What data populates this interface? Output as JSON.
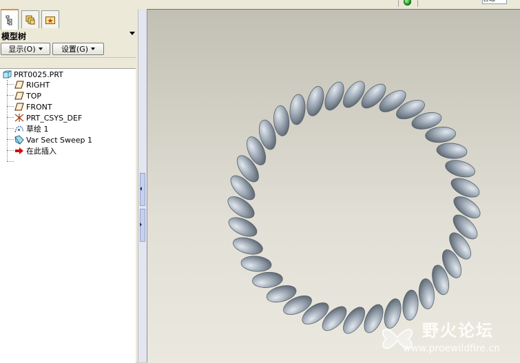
{
  "top_box": {
    "text": "普通"
  },
  "panel": {
    "title": "模型树",
    "show_button": "显示(O)",
    "settings_button": "设置(G)"
  },
  "tabs": [
    {
      "icon": "model-tree-tab-icon",
      "active": true
    },
    {
      "icon": "layers-tab-icon",
      "active": false
    },
    {
      "icon": "favorites-tab-icon",
      "active": false
    }
  ],
  "tree": {
    "root": "PRT0025.PRT",
    "items": [
      {
        "label": "RIGHT",
        "icon": "datum-plane-icon"
      },
      {
        "label": "TOP",
        "icon": "datum-plane-icon"
      },
      {
        "label": "FRONT",
        "icon": "datum-plane-icon"
      },
      {
        "label": "PRT_CSYS_DEF",
        "icon": "csys-icon"
      },
      {
        "label": "草绘 1",
        "icon": "sketch-icon"
      },
      {
        "label": "Var Sect Sweep 1",
        "icon": "var-sect-sweep-icon"
      },
      {
        "label": "在此插入",
        "icon": "insert-here-arrow-icon"
      }
    ]
  },
  "watermark": {
    "name": "野火论坛",
    "url": "www.proewildfire.cn"
  },
  "colors": {
    "model": "#9aa6b3",
    "insert_arrow": "#cc1111",
    "status_led": "#1a8a1a"
  }
}
